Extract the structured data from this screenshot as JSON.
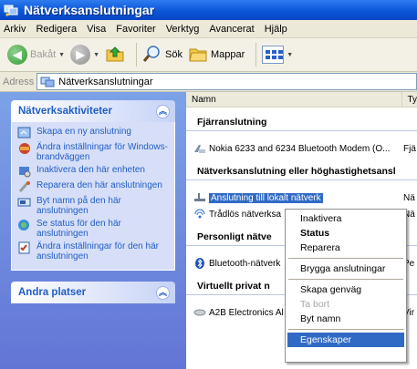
{
  "window": {
    "title": "Nätverksanslutningar"
  },
  "menu": [
    "Arkiv",
    "Redigera",
    "Visa",
    "Favoriter",
    "Verktyg",
    "Avancerat",
    "Hjälp"
  ],
  "toolbar": {
    "back": "Bakåt",
    "search": "Sök",
    "folders": "Mappar"
  },
  "address": {
    "label": "Adress",
    "value": "Nätverksanslutningar"
  },
  "taskpane": {
    "network_tasks_title": "Nätverksaktiviteter",
    "tasks": [
      "Skapa en ny anslutning",
      "Ändra inställningar för Windows-brandväggen",
      "Inaktivera den här enheten",
      "Reparera den här anslutningen",
      "Byt namn på den här anslutningen",
      "Se status för den här anslutningen",
      "Ändra inställningar för den här anslutningen"
    ],
    "other_places_title": "Andra platser"
  },
  "columns": {
    "name": "Namn",
    "type": "Ty"
  },
  "sections": [
    {
      "title": "Fjärranslutning",
      "items": [
        {
          "name": "Nokia 6233 and 6234 Bluetooth Modem (O...",
          "type": "Fjä"
        }
      ]
    },
    {
      "title": "Nätverksanslutning eller höghastighetsansl",
      "items": [
        {
          "name": "Anslutning till lokalt nätverk",
          "type": "Nä",
          "selected": true
        },
        {
          "name": "Trådlös nätverksa",
          "type": "Nä"
        }
      ]
    },
    {
      "title": "Personligt nätve",
      "items": [
        {
          "name": "Bluetooth-nätverk",
          "type": "Pe"
        }
      ]
    },
    {
      "title": "Virtuellt privat n",
      "items": [
        {
          "name": "A2B Electronics Al",
          "type": "Vir"
        }
      ]
    }
  ],
  "context_menu": {
    "items": [
      "Inaktivera",
      "Status",
      "Reparera",
      "Brygga anslutningar",
      "Skapa genväg",
      "Ta bort",
      "Byt namn",
      "Egenskaper"
    ]
  },
  "colors": {
    "title_bar": "#0a56d8",
    "task_pane": "#7ba2e7",
    "link": "#215dc6",
    "selection": "#316ac5"
  }
}
